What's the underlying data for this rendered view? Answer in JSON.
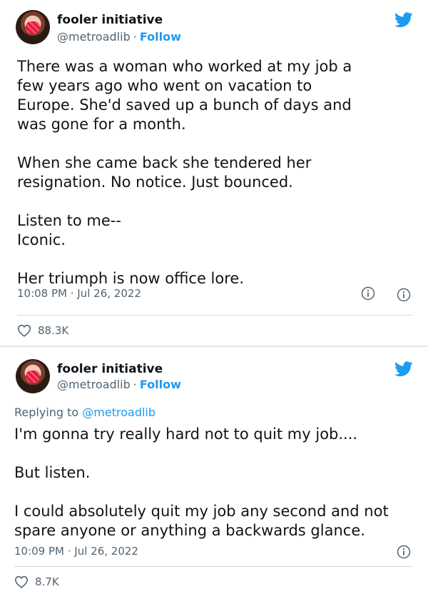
{
  "tweets": [
    {
      "author": {
        "name": "fooler initiative",
        "handle": "@metroadlib",
        "separator": "·",
        "follow_label": "Follow"
      },
      "lines": [
        "There was a woman who worked at my job a",
        "few years ago who went on vacation to",
        "Europe. She'd saved up a bunch of days and",
        "was gone for a month.",
        "",
        "When she came back she tendered her",
        "resignation. No notice. Just bounced.",
        "",
        "Listen to me--",
        "Iconic.",
        "",
        "Her triumph is now office lore."
      ],
      "timestamp": "10:08 PM · Jul 26, 2022",
      "likes": "88.3K"
    },
    {
      "author": {
        "name": "fooler initiative",
        "handle": "@metroadlib",
        "separator": "·",
        "follow_label": "Follow"
      },
      "replying_prefix": "Replying to",
      "replying_mention": "@metroadlib",
      "lines": [
        "I'm gonna try really hard not to quit my job....",
        "",
        "But listen.",
        "",
        "I could absolutely quit my job any second and not",
        "spare anyone or anything a backwards glance."
      ],
      "timestamp": "10:09 PM · Jul 26, 2022",
      "likes": "8.7K"
    }
  ],
  "colors": {
    "link": "#1d9bf0",
    "muted": "#536471",
    "text": "#0f1419",
    "divider": "#cfd9de"
  },
  "icons": [
    "twitter-bird-icon",
    "info-icon",
    "heart-icon"
  ]
}
